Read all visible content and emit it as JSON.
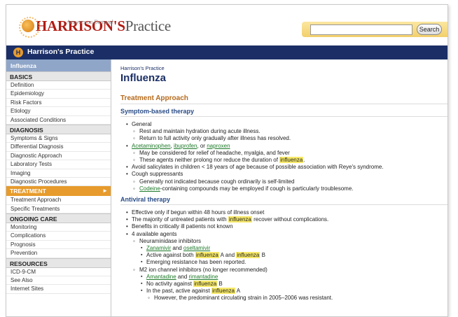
{
  "header": {
    "brand": "HARRISON'S",
    "practice": "Practice",
    "tagline": "Answers on Demand",
    "search_placeholder": "",
    "search_button": "Search"
  },
  "topbar": {
    "icon_letter": "H",
    "title": "Harrison's Practice"
  },
  "sidebar": {
    "current_topic": "Influenza",
    "sections": [
      {
        "title": "BASICS",
        "items": [
          "Definition",
          "Epidemiology",
          "Risk Factors",
          "Etiology",
          "Associated Conditions"
        ]
      },
      {
        "title": "DIAGNOSIS",
        "items": [
          "Symptoms & Signs",
          "Differential Diagnosis",
          "Diagnostic Approach",
          "Laboratory Tests",
          "Imaging",
          "Diagnostic Procedures"
        ]
      },
      {
        "title": "TREATMENT",
        "active": true,
        "items": [
          "Treatment Approach",
          "Specific Treatments"
        ]
      },
      {
        "title": "ONGOING CARE",
        "items": [
          "Monitoring",
          "Complications",
          "Prognosis",
          "Prevention"
        ]
      },
      {
        "title": "RESOURCES",
        "items": [
          "ICD-9-CM",
          "See Also",
          "Internet Sites"
        ]
      }
    ]
  },
  "content": {
    "breadcrumb": "Harrison's Practice",
    "title": "Influenza",
    "section_heading": "Treatment Approach",
    "symptom": {
      "heading": "Symptom-based therapy",
      "general": "General",
      "general_sub": [
        "Rest and maintain hydration during acute illness.",
        "Return to full activity only gradually after illness has resolved."
      ],
      "drug_links": [
        "Acetaminophen",
        "ibuprofen",
        "naproxen"
      ],
      "drug_sep1": ", ",
      "drug_sep2": ", or ",
      "drug_sub1": "May be considered for relief of headache, myalgia, and fever",
      "drug_sub2_pre": "These agents neither prolong nor reduce the duration of ",
      "drug_sub2_hl": "influenza",
      "drug_sub2_post": ".",
      "salicylates": "Avoid salicylates in children < 18 years of age because of possible association with Reye's syndrome.",
      "cough": "Cough suppressants",
      "cough_sub1": "Generally not indicated because cough ordinarily is self-limited",
      "cough_link": "Codeine",
      "cough_sub2_post": "-containing compounds may be employed if cough is particularly troublesome."
    },
    "antiviral": {
      "heading": "Antiviral therapy",
      "item1": "Effective only if begun within 48 hours of illness onset",
      "item2_pre": "The majority of untreated patients with ",
      "item2_hl": "influenza",
      "item2_post": " recover without complications.",
      "item3": "Benefits in critically ill patients not known",
      "item4": "4 available agents",
      "neur": "Neuraminidase inhibitors",
      "neur_links": [
        "Zanamivir",
        "oseltamivir"
      ],
      "and": " and ",
      "neur_active_pre": "Active against both ",
      "hl_word": "influenza",
      "neur_active_mid": " A and ",
      "neur_active_post": " B",
      "neur_resist": "Emerging resistance has been reported.",
      "m2": "M2 ion channel inhibitors (no longer recommended)",
      "m2_links": [
        "Amantadine",
        "rimantadine"
      ],
      "m2_noact_pre": "No activity against ",
      "m2_noact_post": " B",
      "m2_past_pre": "In the past, active against ",
      "m2_past_post": " A",
      "m2_however": "However, the predominant circulating strain in 2005–2006 was resistant."
    }
  }
}
